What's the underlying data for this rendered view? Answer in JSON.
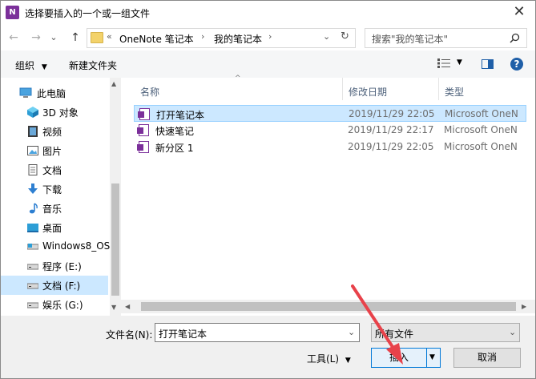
{
  "window": {
    "title": "选择要插入的一个或一组文件",
    "app_icon": "N"
  },
  "nav": {
    "back": "←",
    "forward": "→",
    "dropdown": "⌄",
    "up": "↑",
    "breadcrumb": [
      "«",
      "OneNote 笔记本",
      "›",
      "我的笔记本",
      "›"
    ],
    "search_placeholder": "搜索\"我的笔记本\""
  },
  "toolbar": {
    "organize": "组织",
    "new_folder": "新建文件夹"
  },
  "sidebar": {
    "items": [
      {
        "label": "此电脑",
        "icon": "computer-icon"
      },
      {
        "label": "3D 对象",
        "icon": "cube-icon"
      },
      {
        "label": "视频",
        "icon": "video-icon"
      },
      {
        "label": "图片",
        "icon": "picture-icon"
      },
      {
        "label": "文档",
        "icon": "document-icon"
      },
      {
        "label": "下载",
        "icon": "download-icon"
      },
      {
        "label": "音乐",
        "icon": "music-icon"
      },
      {
        "label": "桌面",
        "icon": "desktop-icon"
      },
      {
        "label": "Windows8_OS",
        "icon": "drive-icon"
      },
      {
        "label": "程序 (E:)",
        "icon": "drive-icon"
      },
      {
        "label": "文档 (F:)",
        "icon": "drive-icon"
      },
      {
        "label": "娱乐 (G:)",
        "icon": "drive-icon"
      }
    ],
    "selected_index": 10
  },
  "columns": {
    "name": "名称",
    "modified": "修改日期",
    "type": "类型"
  },
  "files": [
    {
      "name": "打开笔记本",
      "modified": "2019/11/29 22:05",
      "type": "Microsoft OneN"
    },
    {
      "name": "快速笔记",
      "modified": "2019/11/29 22:17",
      "type": "Microsoft OneN"
    },
    {
      "name": "新分区 1",
      "modified": "2019/11/29 22:05",
      "type": "Microsoft OneN"
    }
  ],
  "footer": {
    "filename_label": "文件名(N):",
    "filename_value": "打开笔记本",
    "filetype_value": "所有文件",
    "tools_label": "工具(L)",
    "insert_label": "插入",
    "cancel_label": "取消"
  },
  "colors": {
    "selection": "#cce8ff",
    "onenote_purple": "#7b2f9a",
    "annotation_arrow": "#e8424a"
  }
}
